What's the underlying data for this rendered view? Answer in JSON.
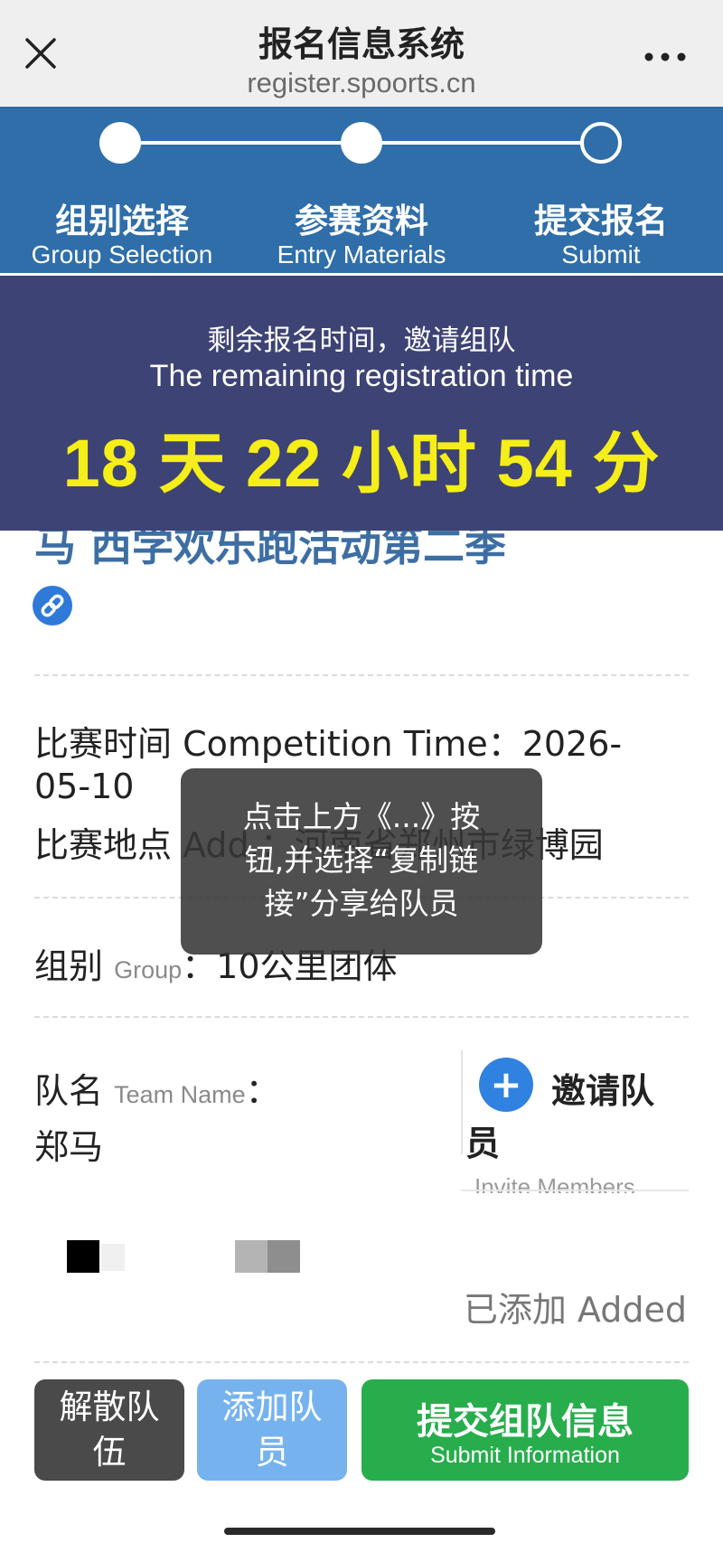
{
  "top_bar": {
    "title": "报名信息系统",
    "url": "register.spoorts.cn",
    "close_icon": "close-icon",
    "more_icon": "more-icon"
  },
  "steps": [
    {
      "title": "组别选择",
      "subtitle": "Group Selection",
      "status": "done"
    },
    {
      "title": "参赛资料",
      "subtitle": "Entry Materials",
      "status": "done"
    },
    {
      "title": "提交报名",
      "subtitle": "Submit",
      "status": "pending"
    }
  ],
  "countdown": {
    "label_cn": "剩余报名时间，邀请组队",
    "label_en": "The remaining registration time",
    "value": "18 天 22 小时 54 分"
  },
  "event": {
    "title_fragment": "马 西学欢乐跑活动第二季",
    "link_icon": "link-icon"
  },
  "info": {
    "time_line1": "比赛时间 Competition Time：2026-",
    "time_line2": "05-10",
    "address": "比赛地点 Add.：河南省郑州市绿博园",
    "group_label": "组别",
    "group_label_en": "Group",
    "group_value": "：10公里团体",
    "team_label": "队名",
    "team_label_en": "Team Name",
    "team_colon": "：",
    "team_value": "郑马"
  },
  "invite": {
    "plus": "+",
    "label_part1": "邀请队",
    "label_part2": "员",
    "label_en": "Invite Members"
  },
  "members": {
    "added_label": "已添加 Added"
  },
  "buttons": {
    "disband_line1": "解散队",
    "disband_line2": "伍",
    "add_line1": "添加队",
    "add_line2": "员",
    "submit_cn": "提交组队信息",
    "submit_en": "Submit Information"
  },
  "toast": {
    "line1": "点击上方《...》按",
    "line2": "钮,并选择“复制链",
    "line3": "接”分享给队员"
  },
  "colors": {
    "steps_bg": "#2f6ea9",
    "banner_bg": "#3d4374",
    "countdown": "#f5ee18",
    "submit_btn": "#27ad4c",
    "add_btn": "#76b3ee",
    "disband_btn": "#4a4a4a",
    "invite_btn": "#2f82e0"
  }
}
